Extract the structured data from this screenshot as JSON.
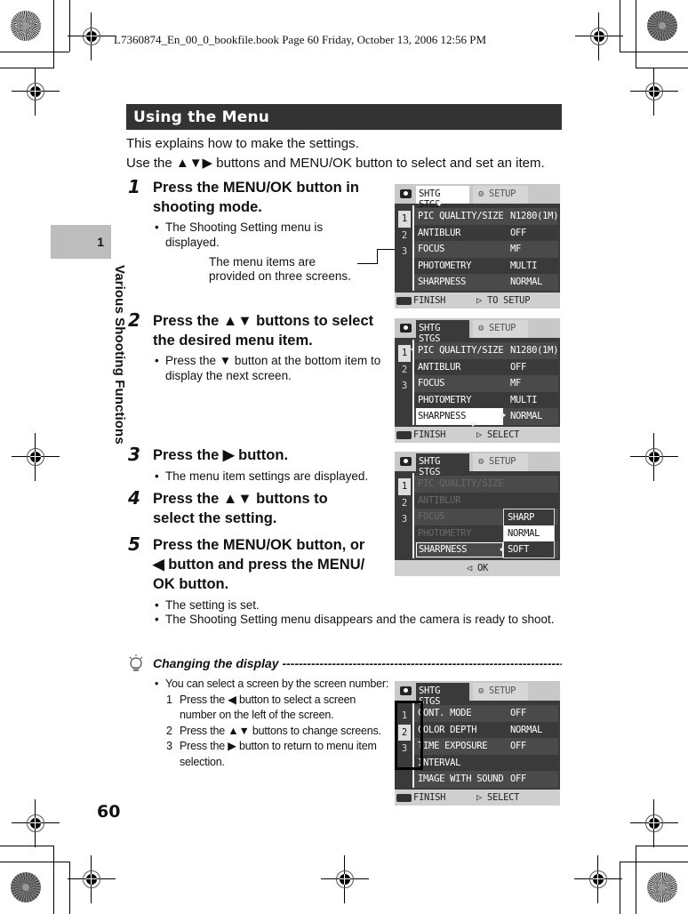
{
  "slug": "L7360874_En_00_0_bookfile.book  Page 60  Friday, October 13, 2006  12:56 PM",
  "chapter_tab": {
    "number": "1",
    "title": "Various Shooting Functions"
  },
  "section_title": "Using the Menu",
  "intro": [
    "This explains how to make the settings.",
    "Use the ▲▼▶ buttons and MENU/OK button to select and set an item."
  ],
  "steps": [
    {
      "num": "1",
      "title_lines": [
        "Press the MENU/OK button in",
        "shooting mode."
      ],
      "bullets": [
        "The Shooting Setting menu is displayed."
      ],
      "callout": [
        "The menu items are",
        "provided on three screens."
      ]
    },
    {
      "num": "2",
      "title_lines": [
        "Press the ▲▼ buttons to select",
        "the desired menu item."
      ],
      "bullets": [
        "Press the ▼ button at the bottom item to display the next screen."
      ]
    },
    {
      "num": "3",
      "title_lines": [
        "Press the ▶ button."
      ],
      "bullets": [
        "The menu item settings are displayed."
      ]
    },
    {
      "num": "4",
      "title_lines": [
        "Press the ▲▼ buttons to",
        "select the setting."
      ]
    },
    {
      "num": "5",
      "title_lines": [
        "Press the MENU/OK button, or",
        "◀ button and press the MENU/",
        "OK button."
      ],
      "bullets": [
        "The setting is set.",
        "The Shooting Setting menu disappears and the camera is ready to shoot."
      ]
    }
  ],
  "screens": [
    {
      "tab1": "SHTG STGS",
      "tab2": "⚙ SETUP",
      "screen_numbers": [
        "1",
        "2",
        "3"
      ],
      "rows": [
        {
          "label": "PIC QUALITY/SIZE",
          "value": "N1280(1M)"
        },
        {
          "label": "ANTIBLUR",
          "value": "OFF"
        },
        {
          "label": "FOCUS",
          "value": "MF"
        },
        {
          "label": "PHOTOMETRY",
          "value": "MULTI"
        },
        {
          "label": "SHARPNESS",
          "value": "NORMAL"
        }
      ],
      "footer_left": "FINISH",
      "footer_right": "▷ TO SETUP"
    },
    {
      "tab1": "SHTG STGS",
      "tab2": "⚙ SETUP",
      "screen_numbers": [
        "1",
        "2",
        "3"
      ],
      "rows": [
        {
          "label": "PIC QUALITY/SIZE",
          "value": "N1280(1M)"
        },
        {
          "label": "ANTIBLUR",
          "value": "OFF"
        },
        {
          "label": "FOCUS",
          "value": "MF"
        },
        {
          "label": "PHOTOMETRY",
          "value": "MULTI"
        },
        {
          "label": "SHARPNESS",
          "value": "NORMAL"
        }
      ],
      "footer_left": "FINISH",
      "footer_right": "▷ SELECT"
    },
    {
      "tab1": "SHTG STGS",
      "tab2": "⚙ SETUP",
      "screen_numbers": [
        "1",
        "2",
        "3"
      ],
      "rows": [
        {
          "label": "PIC QUALITY/SIZE",
          "value": ""
        },
        {
          "label": "ANTIBLUR",
          "value": ""
        },
        {
          "label": "FOCUS",
          "value": ""
        },
        {
          "label": "PHOTOMETRY",
          "value": ""
        },
        {
          "label": "SHARPNESS",
          "value": ""
        }
      ],
      "options": [
        "SHARP",
        "NORMAL",
        "SOFT"
      ],
      "selected_option": "NORMAL",
      "footer_center": "◁ OK"
    },
    {
      "tab1": "SHTG STGS",
      "tab2": "⚙ SETUP",
      "screen_numbers": [
        "1",
        "2",
        "3"
      ],
      "rows": [
        {
          "label": "CONT. MODE",
          "value": "OFF"
        },
        {
          "label": "COLOR DEPTH",
          "value": "NORMAL"
        },
        {
          "label": "TIME EXPOSURE",
          "value": "OFF"
        },
        {
          "label": "INTERVAL",
          "value": ""
        },
        {
          "label": "IMAGE WITH SOUND",
          "value": "OFF"
        }
      ],
      "footer_left": "FINISH",
      "footer_right": "▷ SELECT"
    }
  ],
  "tip": {
    "title": "Changing the display ----------------------------------------------------------------------------------------",
    "bullet": "You can select a screen by the screen number:",
    "substeps": [
      {
        "n": "1",
        "lines": [
          "Press the ◀ button to select a screen",
          "number on the left of the screen."
        ]
      },
      {
        "n": "2",
        "lines": [
          "Press the ▲▼ buttons to change screens."
        ]
      },
      {
        "n": "3",
        "lines": [
          "Press the ▶ button to return to menu item",
          "selection."
        ]
      }
    ]
  },
  "page_number": "60"
}
